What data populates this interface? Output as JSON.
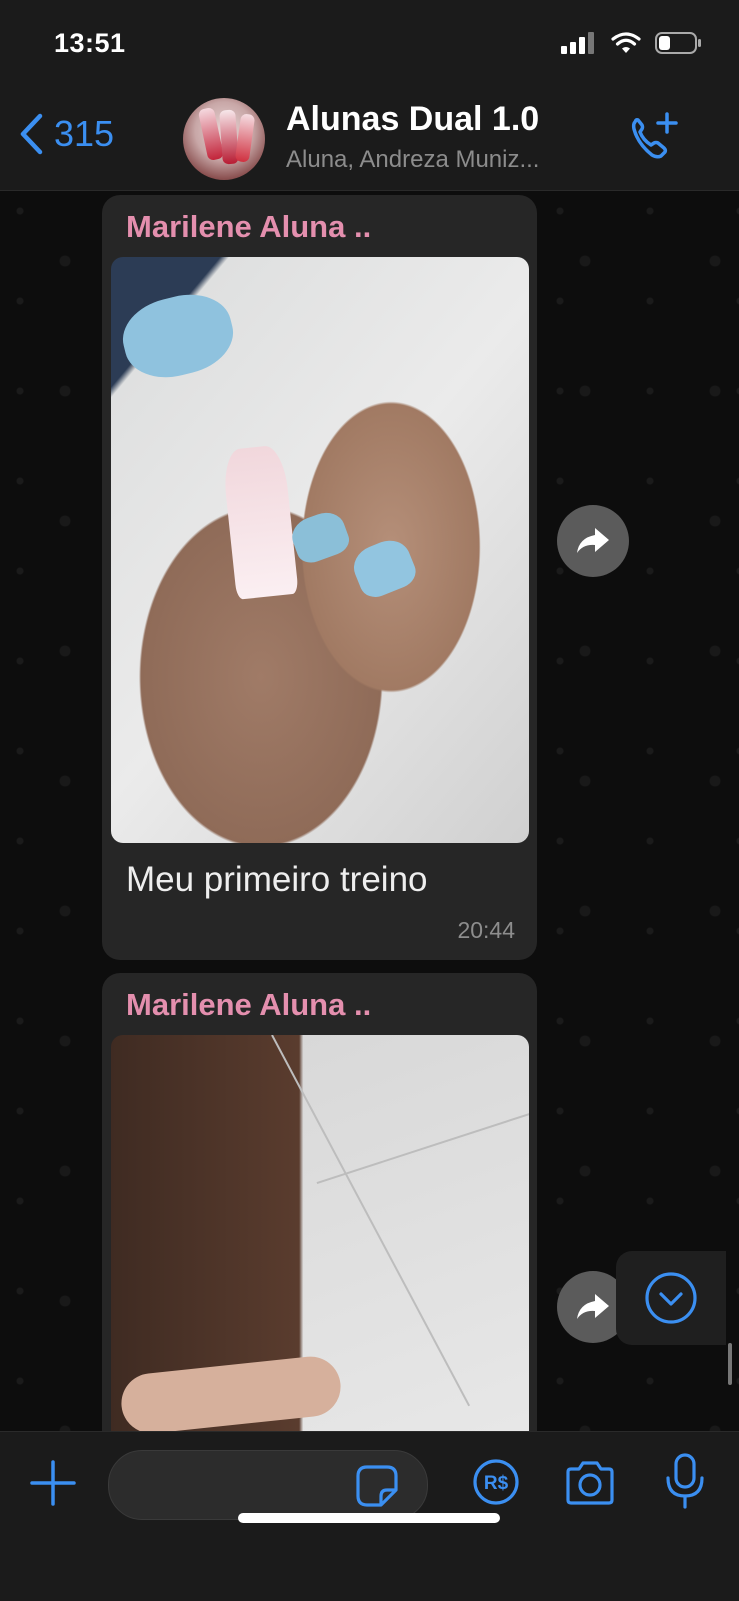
{
  "status_bar": {
    "time": "13:51"
  },
  "header": {
    "back_count": "315",
    "title": "Alunas Dual 1.0",
    "subtitle": "Aluna, Andreza Muniz..."
  },
  "messages": [
    {
      "sender": "Marilene Aluna ..",
      "caption": "Meu primeiro treino",
      "time": "20:44"
    },
    {
      "sender": "Marilene Aluna .."
    }
  ],
  "colors": {
    "accent": "#3b8ff1",
    "sender_name": "#e48fae",
    "bubble": "#262626"
  },
  "icons": [
    "chevron-left-icon",
    "add-call-icon",
    "forward-icon",
    "scroll-down-icon",
    "plus-icon",
    "sticker-icon",
    "payment-icon",
    "camera-icon",
    "microphone-icon"
  ]
}
